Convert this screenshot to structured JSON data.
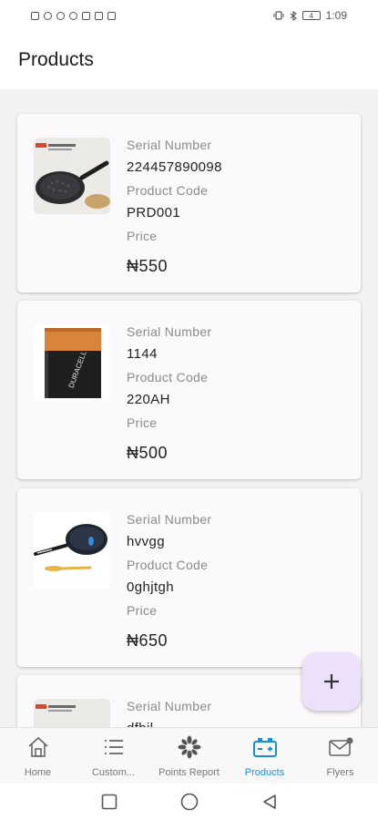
{
  "status_bar": {
    "time": "1:09",
    "battery": "4"
  },
  "app_bar": {
    "title": "Products"
  },
  "labels": {
    "serial": "Serial Number",
    "code": "Product Code",
    "price": "Price"
  },
  "products": [
    {
      "serial_number": "224457890098",
      "product_code": "PRD001",
      "price": "₦550",
      "image": "frying-pan"
    },
    {
      "serial_number": "1144",
      "product_code": "220AH",
      "price": "₦500",
      "image": "battery"
    },
    {
      "serial_number": "hvvgg",
      "product_code": "0ghjtgh",
      "price": "₦650",
      "image": "pan-and-spatula"
    },
    {
      "serial_number": "dfbjl",
      "product_code": "",
      "price": "",
      "image": "frying-pan"
    }
  ],
  "fab": {
    "icon": "plus-icon"
  },
  "bottom_nav": {
    "items": [
      {
        "label": "Home",
        "icon": "home-icon",
        "active": false
      },
      {
        "label": "Custom...",
        "icon": "list-icon",
        "active": false
      },
      {
        "label": "Points Report",
        "icon": "pinwheel-icon",
        "active": false
      },
      {
        "label": "Products",
        "icon": "products-icon",
        "active": true
      },
      {
        "label": "Flyers",
        "icon": "mail-icon",
        "active": false
      }
    ],
    "active_color": "#1a8fd8"
  },
  "system_nav": [
    "square-icon",
    "circle-icon",
    "back-triangle-icon"
  ]
}
